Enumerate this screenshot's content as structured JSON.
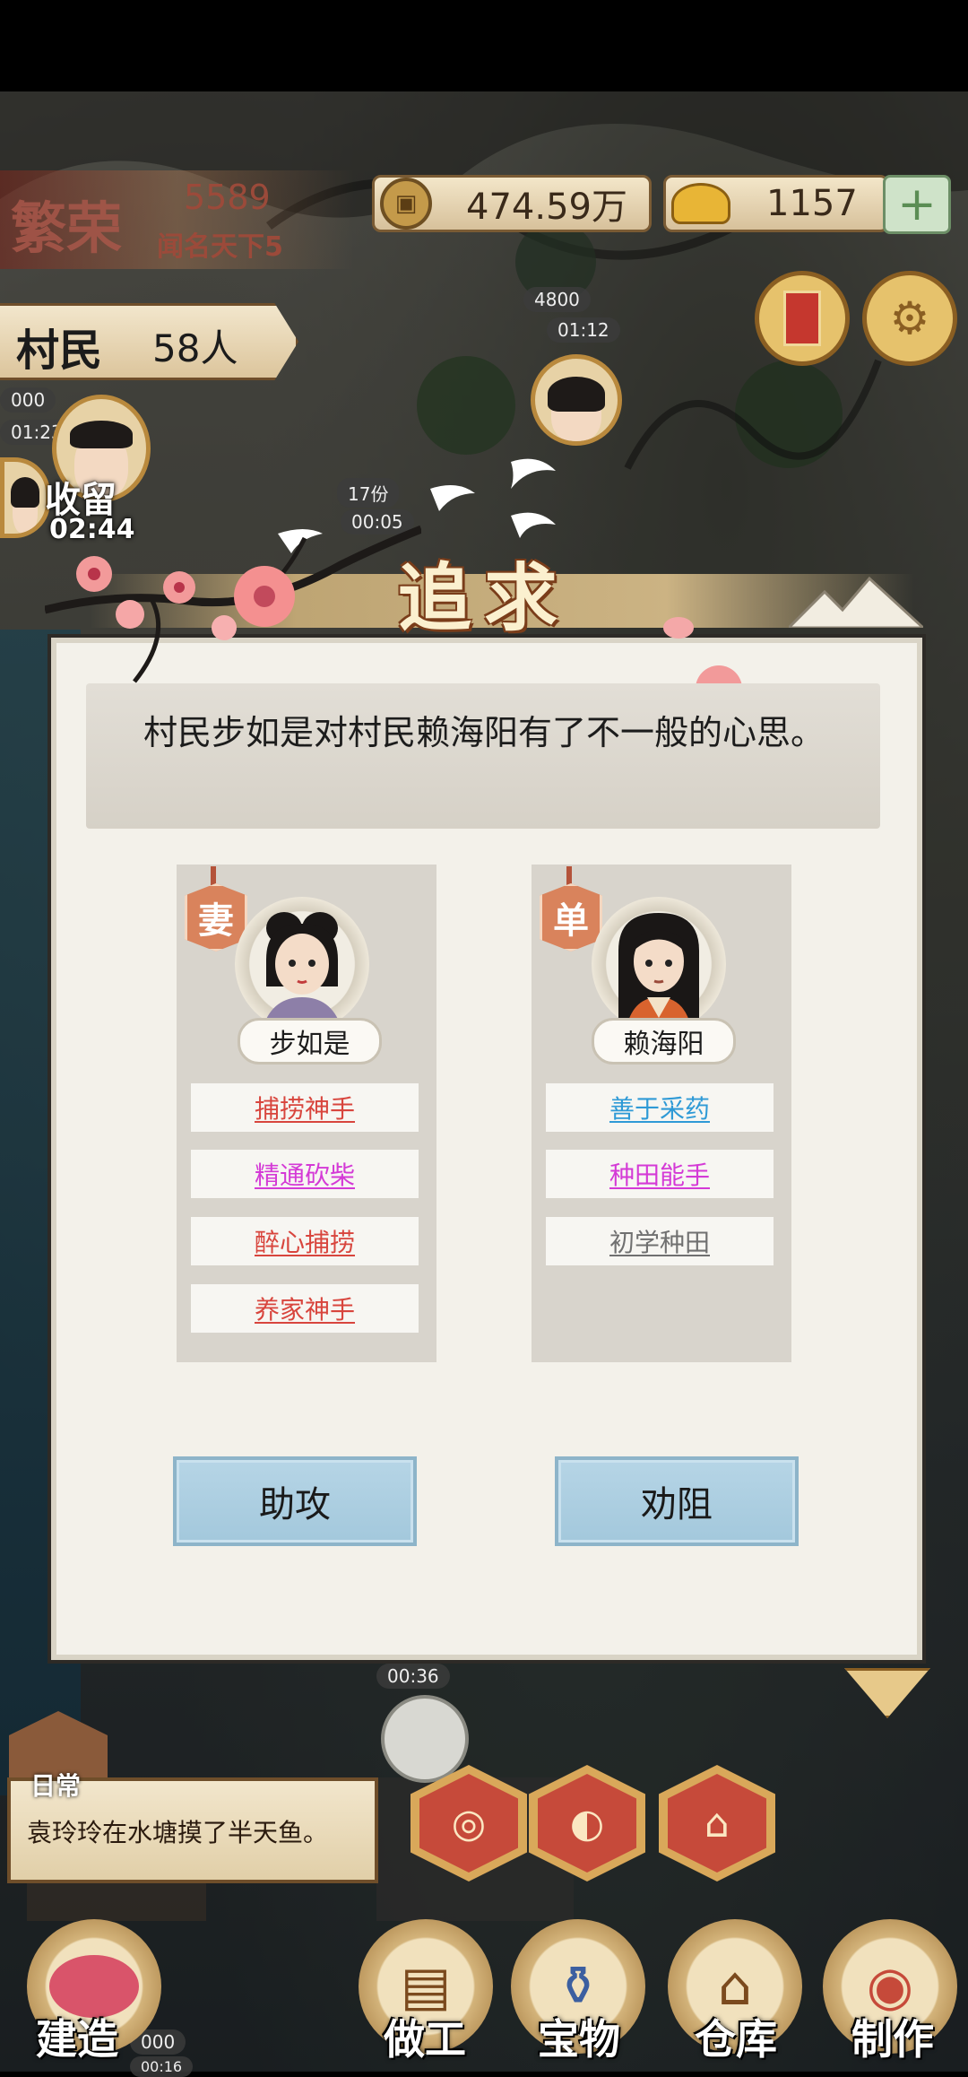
{
  "hud": {
    "prosperity_label": "繁荣",
    "prosperity_value": "5589",
    "fame_text": "闻名天下5",
    "copper_amount": "474.59万",
    "gold_amount": "1157",
    "plus_symbol": "+",
    "villager_label": "村民",
    "villager_count": "58人"
  },
  "map": {
    "top_timer_value": "4800",
    "top_timer_time": "01:12",
    "left_timer_value": "000",
    "left_timer_time": "01:23",
    "shouliu_label": "收留",
    "shouliu_time": "02:44",
    "mid_tag_1": "17份",
    "mid_tag_2": "00:05",
    "bottom_timer": "00:36",
    "bottom_left_timer": "000",
    "bottom_left_time": "00:16"
  },
  "dialog": {
    "title": "追求",
    "message": "村民步如是对村民赖海阳有了不一般的心思。",
    "left": {
      "tag": "妻",
      "name": "步如是",
      "traits": [
        {
          "label": "捕捞神手",
          "color": "#d8453d"
        },
        {
          "label": "精通砍柴",
          "color": "#d43ad6"
        },
        {
          "label": "醉心捕捞",
          "color": "#d8453d"
        },
        {
          "label": "养家神手",
          "color": "#d8453d"
        }
      ]
    },
    "right": {
      "tag": "单",
      "name": "赖海阳",
      "traits": [
        {
          "label": "善于采药",
          "color": "#2f9ad6"
        },
        {
          "label": "种田能手",
          "color": "#d43ad6"
        },
        {
          "label": "初学种田",
          "color": "#707070"
        }
      ]
    },
    "assist_button": "助攻",
    "dissuade_button": "劝阻"
  },
  "bottom": {
    "daily_label": "日常",
    "daily_message": "袁玲玲在水塘摸了半天鱼。",
    "nav": {
      "build": "建造",
      "work": "做工",
      "treasure": "宝物",
      "warehouse": "仓库",
      "craft": "制作"
    }
  },
  "icons": {
    "copper": "copper-coin-icon",
    "gold": "gold-ingot-icon",
    "settings": "gear-icon",
    "letter": "letter-icon"
  }
}
